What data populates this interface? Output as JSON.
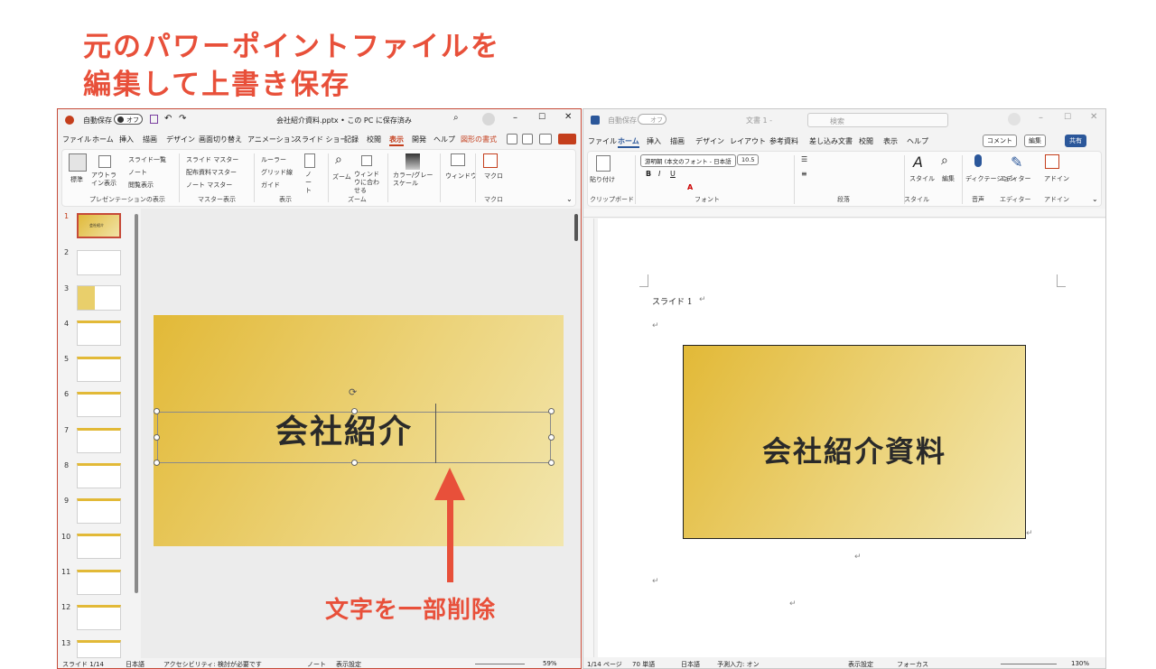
{
  "heading": {
    "line1": "元のパワーポイントファイルを",
    "line2": "編集して上書き保存"
  },
  "annotation": "文字を一部削除",
  "colors": {
    "accent": "#e8503a",
    "ppt_accent": "#c43e1c",
    "word_accent": "#2b579a",
    "slide_gold": "#e2b937"
  },
  "ppt": {
    "autosave": "自動保存",
    "autosave_state": "オフ",
    "filename": "会社紹介資料.pptx • この PC に保存済み",
    "menus": [
      "ファイル",
      "ホーム",
      "挿入",
      "描画",
      "デザイン",
      "画面切り替え",
      "アニメーション",
      "スライド ショー",
      "記録",
      "校閲",
      "表示",
      "開発",
      "ヘルプ",
      "図形の書式"
    ],
    "active_menu": "表示",
    "ribbon": {
      "normal": "標準",
      "outline": "アウトライン表示",
      "slide_list": "スライド一覧",
      "notes": "ノート",
      "reading": "閲覧表示",
      "group_presentation": "プレゼンテーションの表示",
      "slide_master": "スライド マスター",
      "handout_master": "配布資料マスター",
      "notes_master": "ノート マスター",
      "group_master": "マスター表示",
      "ruler": "ルーラー",
      "gridlines": "グリッド線",
      "guides": "ガイド",
      "notes_btn": "ノート",
      "group_show": "表示",
      "zoom": "ズーム",
      "fit_window": "ウィンドウに合わせる",
      "group_zoom": "ズーム",
      "color_gray": "カラー/グレースケール",
      "window": "ウィンドウ",
      "macro": "マクロ",
      "group_macro": "マクロ"
    },
    "slide_numbers": [
      "1",
      "2",
      "3",
      "4",
      "5",
      "6",
      "7",
      "8",
      "9",
      "10",
      "11",
      "12",
      "13"
    ],
    "thumb1_text": "会社紹介",
    "slide_title": "会社紹介",
    "status": {
      "slide": "スライド 1/14",
      "lang": "日本語",
      "accessibility": "アクセシビリティ: 検討が必要です",
      "notes": "ノート",
      "display": "表示設定",
      "zoom": "59%"
    }
  },
  "word": {
    "autosave": "自動保存",
    "autosave_state": "オフ",
    "doc_title": "文書 1 -",
    "search_placeholder": "検索",
    "menus": [
      "ファイル",
      "ホーム",
      "挿入",
      "描画",
      "デザイン",
      "レイアウト",
      "参考資料",
      "差し込み文書",
      "校閲",
      "表示",
      "ヘルプ"
    ],
    "active_menu": "ホーム",
    "comment_btn": "コメント",
    "edit_btn": "編集",
    "share_btn": "共有",
    "ribbon": {
      "paste": "貼り付け",
      "group_clipboard": "クリップボード",
      "font_name": "游明朝 (本文のフォント - 日本語",
      "font_size": "10.5",
      "group_font": "フォント",
      "group_paragraph": "段落",
      "styles": "スタイル",
      "group_styles": "スタイル",
      "editing": "編集",
      "dictate": "ディクテーション",
      "group_voice": "音声",
      "editor": "エディター",
      "group_editor": "エディター",
      "addins": "アドイン",
      "group_addins": "アドイン"
    },
    "doc_heading": "スライド 1",
    "image_title": "会社紹介資料",
    "status": {
      "page": "1/14 ページ",
      "words": "70 単語",
      "lang": "日本語",
      "predict": "予測入力: オン",
      "display": "表示設定",
      "focus": "フォーカス",
      "zoom": "130%"
    }
  }
}
